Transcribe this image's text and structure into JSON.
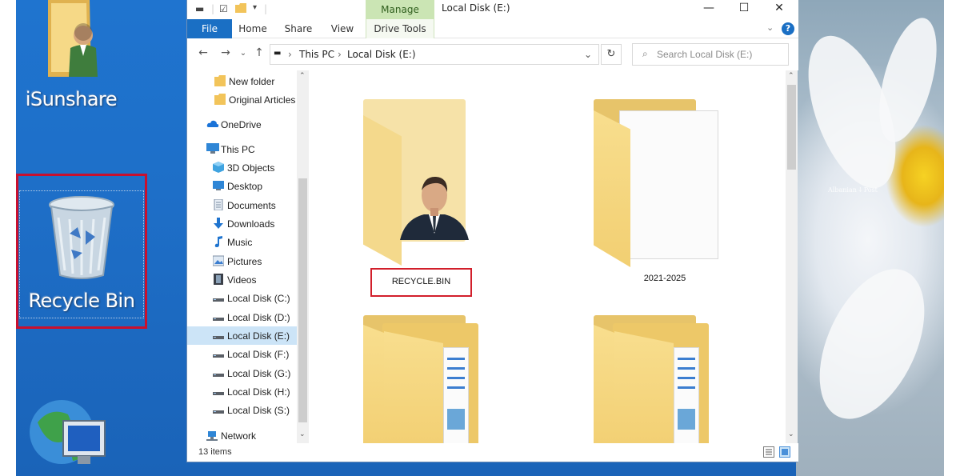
{
  "desktop": {
    "icons": [
      {
        "label": "iSunshare",
        "icon": "user-folder-icon"
      },
      {
        "label": "Recycle Bin",
        "icon": "recycle-bin-icon"
      },
      {
        "label": "",
        "icon": "network-globe-icon"
      }
    ],
    "watermark": "Albanian ⸸ Post"
  },
  "window": {
    "title": "Local Disk (E:)",
    "manage_tab": "Manage",
    "controls": {
      "minimize": "—",
      "maximize": "☐",
      "close": "✕"
    },
    "colors": {
      "file_tab": "#1a6fc4",
      "manage_tab": "#cbe5b4",
      "selected_nav": "#cce4f7",
      "highlight_border": "#d21f2b"
    }
  },
  "ribbon": {
    "tabs": [
      "File",
      "Home",
      "Share",
      "View"
    ],
    "contextual_tab": "Drive Tools",
    "help": "?"
  },
  "address": {
    "breadcrumb": [
      "This PC",
      "Local Disk (E:)"
    ],
    "separator": "›",
    "search_placeholder": "Search Local Disk (E:)"
  },
  "navigation": {
    "items": [
      {
        "label": "New folder",
        "icon": "folder-icon",
        "selected": false
      },
      {
        "label": "Original Articles",
        "icon": "folder-icon",
        "selected": false
      },
      {
        "label": "OneDrive",
        "icon": "cloud-icon",
        "selected": false
      },
      {
        "label": "This PC",
        "icon": "computer-icon",
        "selected": false
      },
      {
        "label": "3D Objects",
        "icon": "cube-icon",
        "selected": false
      },
      {
        "label": "Desktop",
        "icon": "desktop-icon",
        "selected": false
      },
      {
        "label": "Documents",
        "icon": "document-icon",
        "selected": false
      },
      {
        "label": "Downloads",
        "icon": "download-arrow-icon",
        "selected": false
      },
      {
        "label": "Music",
        "icon": "music-note-icon",
        "selected": false
      },
      {
        "label": "Pictures",
        "icon": "pictures-icon",
        "selected": false
      },
      {
        "label": "Videos",
        "icon": "film-icon",
        "selected": false
      },
      {
        "label": "Local Disk (C:)",
        "icon": "drive-icon",
        "selected": false
      },
      {
        "label": "Local Disk (D:)",
        "icon": "drive-icon",
        "selected": false
      },
      {
        "label": "Local Disk (E:)",
        "icon": "drive-icon",
        "selected": true
      },
      {
        "label": "Local Disk (F:)",
        "icon": "drive-icon",
        "selected": false
      },
      {
        "label": "Local Disk (G:)",
        "icon": "drive-icon",
        "selected": false
      },
      {
        "label": "Local Disk (H:)",
        "icon": "drive-icon",
        "selected": false
      },
      {
        "label": "Local Disk (S:)",
        "icon": "drive-icon",
        "selected": false
      },
      {
        "label": "Network",
        "icon": "network-icon",
        "selected": false
      }
    ]
  },
  "content": {
    "items": [
      {
        "label": "RECYCLE.BIN",
        "type": "folder-with-photo",
        "highlighted": true
      },
      {
        "label": "2021-2025",
        "type": "folder-with-paper",
        "highlighted": false
      },
      {
        "label": "",
        "type": "folder-with-documents",
        "highlighted": false
      },
      {
        "label": "",
        "type": "folder-with-documents",
        "highlighted": false
      }
    ]
  },
  "status": {
    "item_count": "13 items"
  }
}
